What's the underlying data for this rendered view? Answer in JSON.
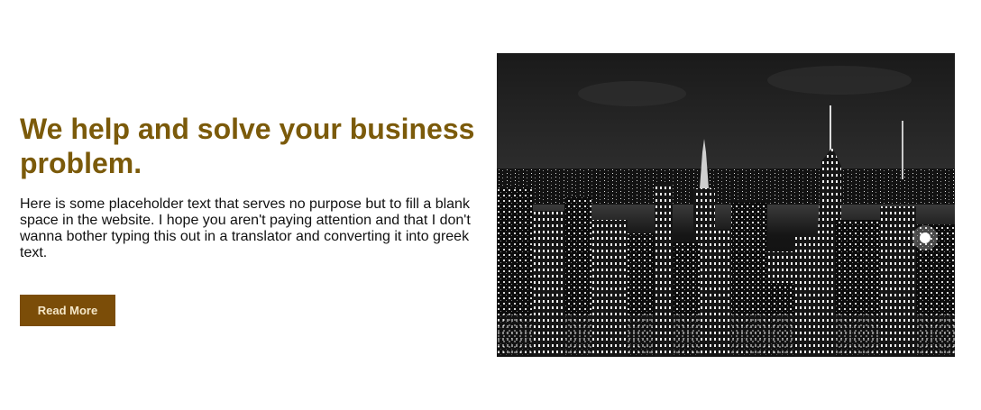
{
  "hero": {
    "headline": "We help and solve your business problem.",
    "body": "Here is some placeholder text that serves no purpose but to fill a blank space in the website. I hope you aren't paying attention and that I don't wanna bother typing this out in a translator and converting it into greek text.",
    "button_label": "Read More"
  },
  "colors": {
    "headline": "#7b5a0a",
    "button_bg": "#7b4d08",
    "button_text": "#f5e7c8"
  },
  "image": {
    "semantic": "black-and-white city skyline at night",
    "icon": "cityscape-photo"
  }
}
